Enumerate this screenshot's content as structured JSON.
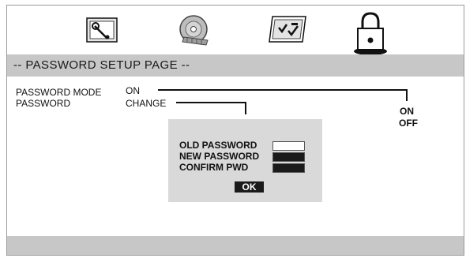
{
  "tabs": [
    {
      "icon": "wrench-settings-icon",
      "state": "inactive"
    },
    {
      "icon": "disc-icon",
      "state": "inactive"
    },
    {
      "icon": "checklist-icon",
      "state": "inactive"
    },
    {
      "icon": "padlock-icon",
      "state": "active"
    }
  ],
  "header": {
    "title": "-- PASSWORD SETUP PAGE --"
  },
  "settings": {
    "password_mode": {
      "label": "PASSWORD MODE",
      "value": "ON"
    },
    "password": {
      "label": "PASSWORD",
      "value": "CHANGE"
    }
  },
  "mode_options": [
    "ON",
    "OFF"
  ],
  "dialog": {
    "old_password_label": "OLD PASSWORD",
    "new_password_label": "NEW PASSWORD",
    "confirm_label": "CONFIRM PWD",
    "ok_label": "OK",
    "old_password_value": "",
    "new_password_value": "",
    "confirm_value": ""
  },
  "colors": {
    "bar": "#c7c7c7",
    "dialog": "#d9d9d9",
    "button": "#1a1a1a",
    "field_filled": "#1a1a1a",
    "field_empty": "#ffffff"
  }
}
